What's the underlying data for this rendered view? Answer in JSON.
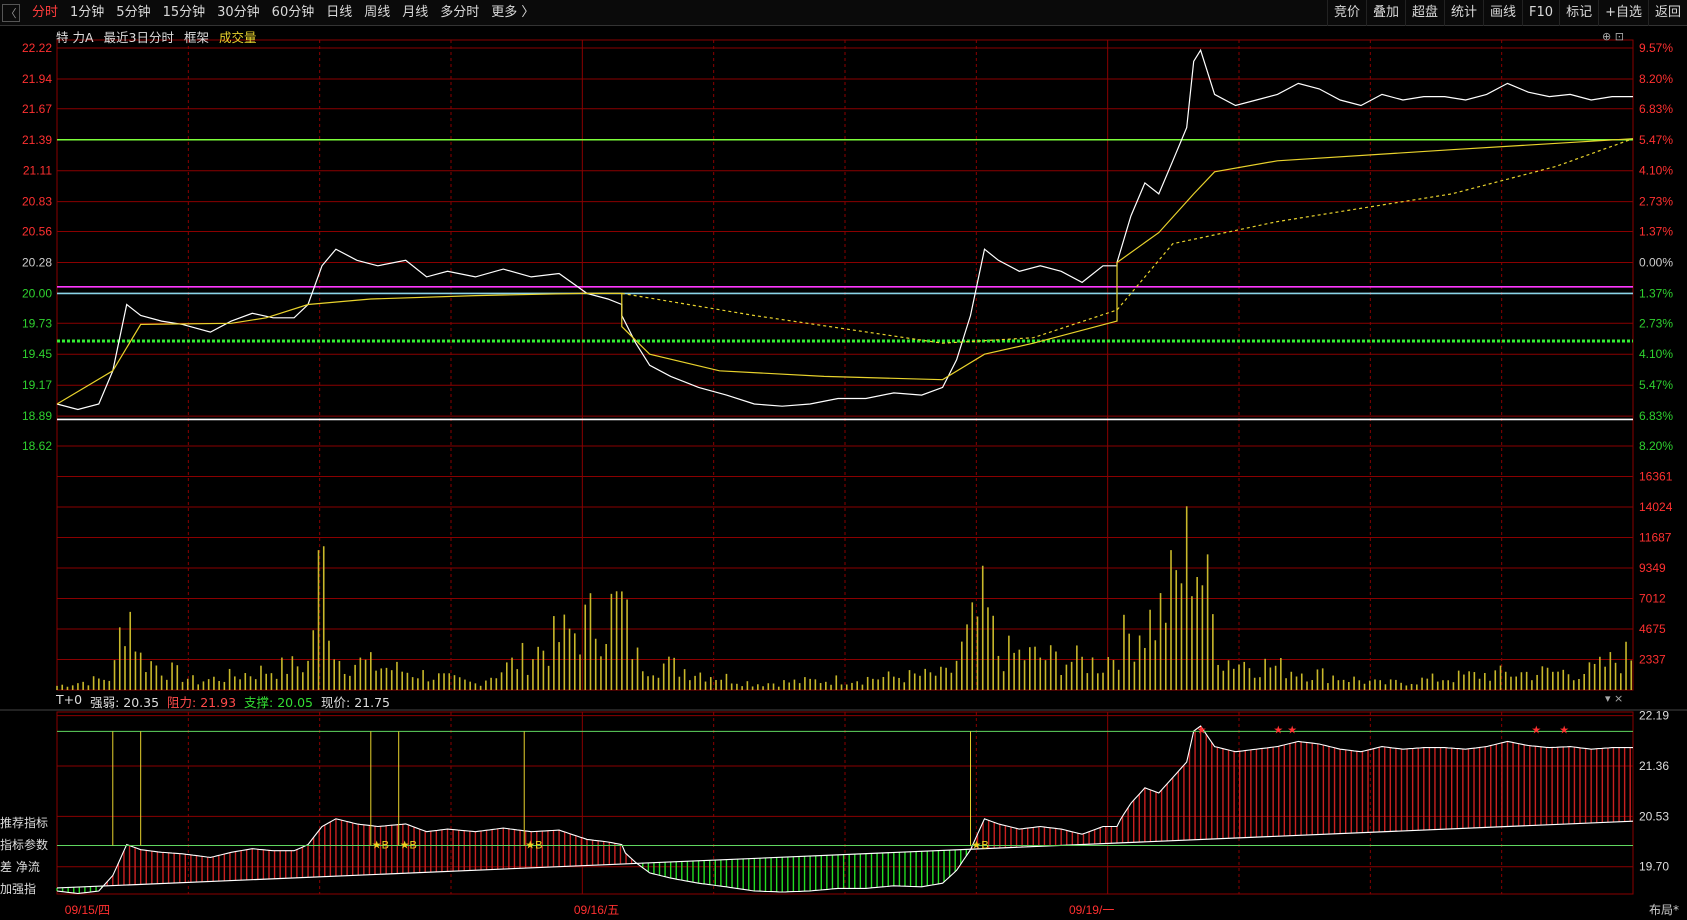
{
  "toolbar": {
    "back_icon": "back-arrow-icon",
    "tabs": [
      "分时",
      "1分钟",
      "5分钟",
      "15分钟",
      "30分钟",
      "60分钟",
      "日线",
      "周线",
      "月线",
      "多分时",
      "更多 〉"
    ],
    "active_tab": "分时",
    "right_buttons": [
      "竞价",
      "叠加",
      "超盘",
      "统计",
      "画线",
      "F10",
      "标记",
      "+自选",
      "返回"
    ]
  },
  "info": {
    "stock": "特 力A",
    "mode": "最近3日分时",
    "frame": "框架",
    "volume_label": "成交量"
  },
  "indicator": {
    "name": "T+0",
    "strength": "强弱: 20.35",
    "resistance": "阻力: 21.93",
    "support": "支撑: 20.05",
    "price": "现价: 21.75"
  },
  "left_labels": [
    "推荐指标",
    "指标参数",
    "差 净流",
    "加强指"
  ],
  "layout_button": "布局*",
  "colors": {
    "up": "#ff3030",
    "down": "#2fd12f",
    "price": "#ffffff",
    "avg": "#e8d22c",
    "grid": "#8a0000"
  },
  "chart_data": {
    "type": "line",
    "price_axis": {
      "ticks": [
        "22.22",
        "21.94",
        "21.67",
        "21.39",
        "21.11",
        "20.83",
        "20.56",
        "20.28",
        "20.00",
        "19.73",
        "19.45",
        "19.17",
        "18.89",
        "18.62"
      ],
      "pct": [
        "9.57%",
        "8.20%",
        "6.83%",
        "5.47%",
        "4.10%",
        "2.73%",
        "1.37%",
        "0.00%",
        "1.37%",
        "2.73%",
        "4.10%",
        "5.47%",
        "6.83%",
        "8.20%"
      ],
      "ylim": [
        18.62,
        22.22
      ],
      "prev_close": 20.28
    },
    "volume_axis": {
      "ticks": [
        "16361",
        "14024",
        "11687",
        "9349",
        "7012",
        "4675",
        "2337"
      ],
      "ylim": [
        0,
        18700
      ]
    },
    "indicator_axis": {
      "ticks": [
        "22.19",
        "21.36",
        "20.53",
        "19.70"
      ],
      "ylim": [
        19.25,
        22.25
      ]
    },
    "x_labels": [
      "09/15/四",
      "09/16/五",
      "09/19/一"
    ],
    "price_series": [
      [
        0,
        19.0
      ],
      [
        3,
        18.95
      ],
      [
        6,
        19.0
      ],
      [
        8,
        19.3
      ],
      [
        10,
        19.9
      ],
      [
        12,
        19.8
      ],
      [
        15,
        19.75
      ],
      [
        18,
        19.72
      ],
      [
        22,
        19.65
      ],
      [
        25,
        19.75
      ],
      [
        28,
        19.82
      ],
      [
        31,
        19.78
      ],
      [
        34,
        19.78
      ],
      [
        36,
        19.9
      ],
      [
        38,
        20.25
      ],
      [
        40,
        20.4
      ],
      [
        43,
        20.3
      ],
      [
        46,
        20.25
      ],
      [
        50,
        20.3
      ],
      [
        53,
        20.15
      ],
      [
        56,
        20.2
      ],
      [
        60,
        20.15
      ],
      [
        64,
        20.22
      ],
      [
        68,
        20.15
      ],
      [
        72,
        20.18
      ],
      [
        76,
        20.0
      ],
      [
        79,
        19.95
      ],
      [
        81,
        19.9
      ],
      [
        81,
        19.8
      ],
      [
        83,
        19.55
      ],
      [
        85,
        19.35
      ],
      [
        88,
        19.25
      ],
      [
        92,
        19.15
      ],
      [
        96,
        19.08
      ],
      [
        100,
        19.0
      ],
      [
        104,
        18.98
      ],
      [
        108,
        19.0
      ],
      [
        112,
        19.05
      ],
      [
        116,
        19.05
      ],
      [
        120,
        19.1
      ],
      [
        124,
        19.08
      ],
      [
        127,
        19.15
      ],
      [
        129,
        19.4
      ],
      [
        131,
        19.8
      ],
      [
        133,
        20.4
      ],
      [
        135,
        20.3
      ],
      [
        138,
        20.2
      ],
      [
        141,
        20.25
      ],
      [
        144,
        20.2
      ],
      [
        147,
        20.1
      ],
      [
        150,
        20.25
      ],
      [
        152,
        20.25
      ],
      [
        152,
        20.28
      ],
      [
        154,
        20.7
      ],
      [
        156,
        21.0
      ],
      [
        158,
        20.9
      ],
      [
        160,
        21.2
      ],
      [
        162,
        21.5
      ],
      [
        163,
        22.1
      ],
      [
        164,
        22.2
      ],
      [
        166,
        21.8
      ],
      [
        169,
        21.7
      ],
      [
        172,
        21.75
      ],
      [
        175,
        21.8
      ],
      [
        178,
        21.9
      ],
      [
        181,
        21.85
      ],
      [
        184,
        21.75
      ],
      [
        187,
        21.7
      ],
      [
        190,
        21.8
      ],
      [
        193,
        21.75
      ],
      [
        196,
        21.78
      ],
      [
        199,
        21.78
      ],
      [
        202,
        21.75
      ],
      [
        205,
        21.8
      ],
      [
        208,
        21.9
      ],
      [
        211,
        21.82
      ],
      [
        214,
        21.78
      ],
      [
        217,
        21.8
      ],
      [
        220,
        21.75
      ],
      [
        223,
        21.78
      ],
      [
        226,
        21.78
      ]
    ],
    "avg_series": [
      [
        0,
        19.0
      ],
      [
        8,
        19.3
      ],
      [
        12,
        19.72
      ],
      [
        25,
        19.73
      ],
      [
        30,
        19.78
      ],
      [
        36,
        19.9
      ],
      [
        45,
        19.95
      ],
      [
        60,
        19.98
      ],
      [
        75,
        20.0
      ],
      [
        81,
        20.0
      ],
      [
        81,
        19.7
      ],
      [
        85,
        19.45
      ],
      [
        95,
        19.3
      ],
      [
        110,
        19.25
      ],
      [
        127,
        19.22
      ],
      [
        133,
        19.45
      ],
      [
        140,
        19.55
      ],
      [
        152,
        19.75
      ],
      [
        152,
        20.28
      ],
      [
        158,
        20.55
      ],
      [
        163,
        20.9
      ],
      [
        166,
        21.1
      ],
      [
        175,
        21.2
      ],
      [
        200,
        21.3
      ],
      [
        226,
        21.4
      ]
    ],
    "ref_lines": [
      21.39,
      20.06,
      20.0,
      19.57,
      18.86
    ],
    "volume_profile": [
      [
        0,
        400
      ],
      [
        8,
        1200
      ],
      [
        10,
        9000
      ],
      [
        12,
        3000
      ],
      [
        20,
        800
      ],
      [
        36,
        2500
      ],
      [
        38,
        13000
      ],
      [
        40,
        3000
      ],
      [
        60,
        600
      ],
      [
        81,
        8000
      ],
      [
        83,
        3000
      ],
      [
        100,
        600
      ],
      [
        128,
        1500
      ],
      [
        133,
        8000
      ],
      [
        135,
        3500
      ],
      [
        150,
        2500
      ],
      [
        154,
        5500
      ],
      [
        158,
        7000
      ],
      [
        160,
        9500
      ],
      [
        163,
        14500
      ],
      [
        165,
        9000
      ],
      [
        167,
        3000
      ],
      [
        190,
        600
      ],
      [
        205,
        1500
      ],
      [
        220,
        1800
      ],
      [
        226,
        3500
      ]
    ],
    "indicator_marks": [
      {
        "label": "★B",
        "x": 45
      },
      {
        "label": "★B",
        "x": 49
      },
      {
        "label": "★B",
        "x": 67
      },
      {
        "label": "★B",
        "x": 131
      }
    ]
  }
}
